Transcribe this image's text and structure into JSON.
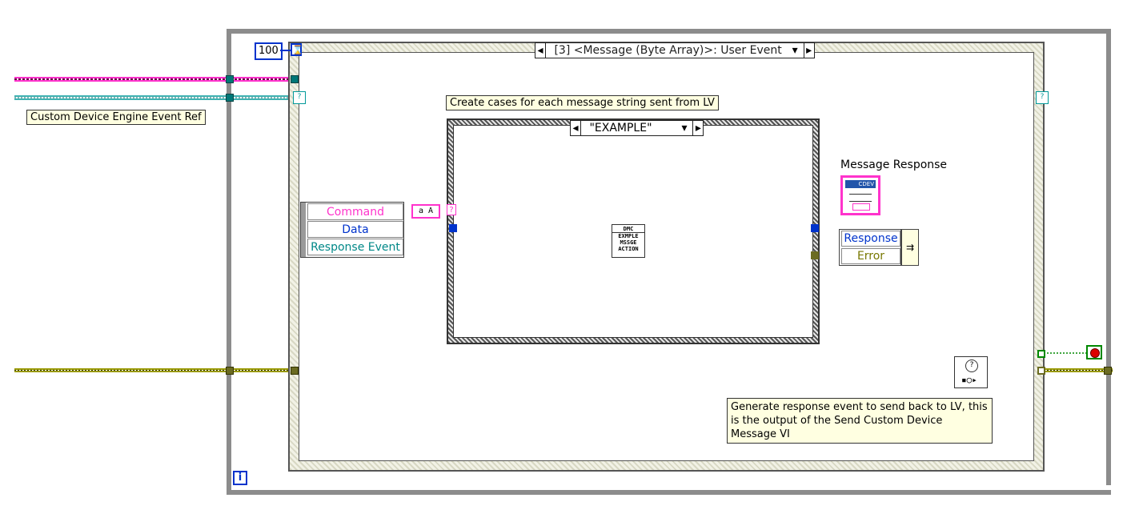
{
  "timeout_constant": "100",
  "event_case_selector": "[3] <Message (Byte Array)>: User Event",
  "event_ref_label": "Custom Device Engine Event Ref",
  "case_comment": "Create cases for each message string sent from LV",
  "case_selector": "\"EXAMPLE\"",
  "unbundle": {
    "items": [
      "Command",
      "Data",
      "Response Event"
    ]
  },
  "string_const_icon": "a A",
  "example_vi": {
    "line1": "DMC",
    "line2": "EXMPLE",
    "line3": "MSSGE",
    "line4": "ACTION"
  },
  "message_response_label": "Message Response",
  "cdev_icon_text": "CDEV",
  "bundle": {
    "items": [
      "Response",
      "Error"
    ]
  },
  "response_comment": "Generate response event to send back to LV, this is the output of the Send Custom Device Message VI",
  "iteration_terminal": "i",
  "colors": {
    "cluster_pink": "#ff33cc",
    "blue_wire": "#0033cc",
    "teal_wire": "#009999",
    "error_wire": "#999900",
    "loop_border": "#8c8c8c",
    "label_bg": "#ffffe1"
  }
}
